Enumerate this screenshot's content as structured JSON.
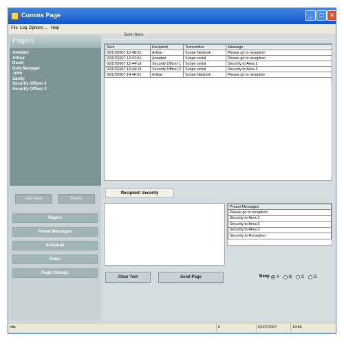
{
  "window": {
    "title": "Comms Page"
  },
  "title_buttons": {
    "minimize": "_",
    "maximize": "□",
    "close": "✕"
  },
  "menu": [
    "File",
    "Log",
    "Options ...",
    "Help"
  ],
  "sidebar": {
    "header": "Pagers",
    "pagers": [
      "Annabel",
      "Arthur",
      "David",
      "Duty Manager",
      "John",
      "Sandy",
      "Security Officer 1",
      "Security Officer 2"
    ]
  },
  "sidebar_buttons": {
    "add_new": "Add New",
    "delete": "Delete"
  },
  "nav": [
    "Pagers",
    "Preset Messages",
    "Schedule",
    "Email",
    "Pager Groups"
  ],
  "sent": {
    "label": "Sent Items",
    "columns": [
      "Sent",
      "Recipient",
      "Transmitter",
      "Message"
    ],
    "rows": [
      [
        "02/07/2007 12:40:51",
        "Arthur",
        "Scope Network",
        "Please go to reception"
      ],
      [
        "02/07/2007 12:41:51",
        "Annabel",
        "Scope serial",
        "Please go to reception"
      ],
      [
        "02/07/2007 12:44:18",
        "Security Officer 1",
        "Scope serial",
        "Security to Area 2"
      ],
      [
        "02/07/2007 12:44:18",
        "Security Officer 2",
        "Scope serial",
        "Security to Area 2"
      ],
      [
        "02/07/2007 14:40:01",
        "Arthur",
        "Scope Network",
        "Please go to reception"
      ]
    ]
  },
  "recipients_label": "Recipient: Security",
  "message_text": "",
  "preset": {
    "column": "Preset Messages",
    "items": [
      "Please go to reception",
      "Security to Area 1",
      "Security to Area 2",
      "Security to Area 3",
      "Security to Reception"
    ]
  },
  "actions": {
    "clear_text": "Clear Text",
    "send_page": "Send Page"
  },
  "beep": {
    "label": "Beep",
    "options": [
      "A",
      "B",
      "C",
      "D"
    ],
    "selected": "A"
  },
  "status": {
    "left": "Idle",
    "count": "0",
    "date": "02/07/2007",
    "time": "14:56"
  }
}
